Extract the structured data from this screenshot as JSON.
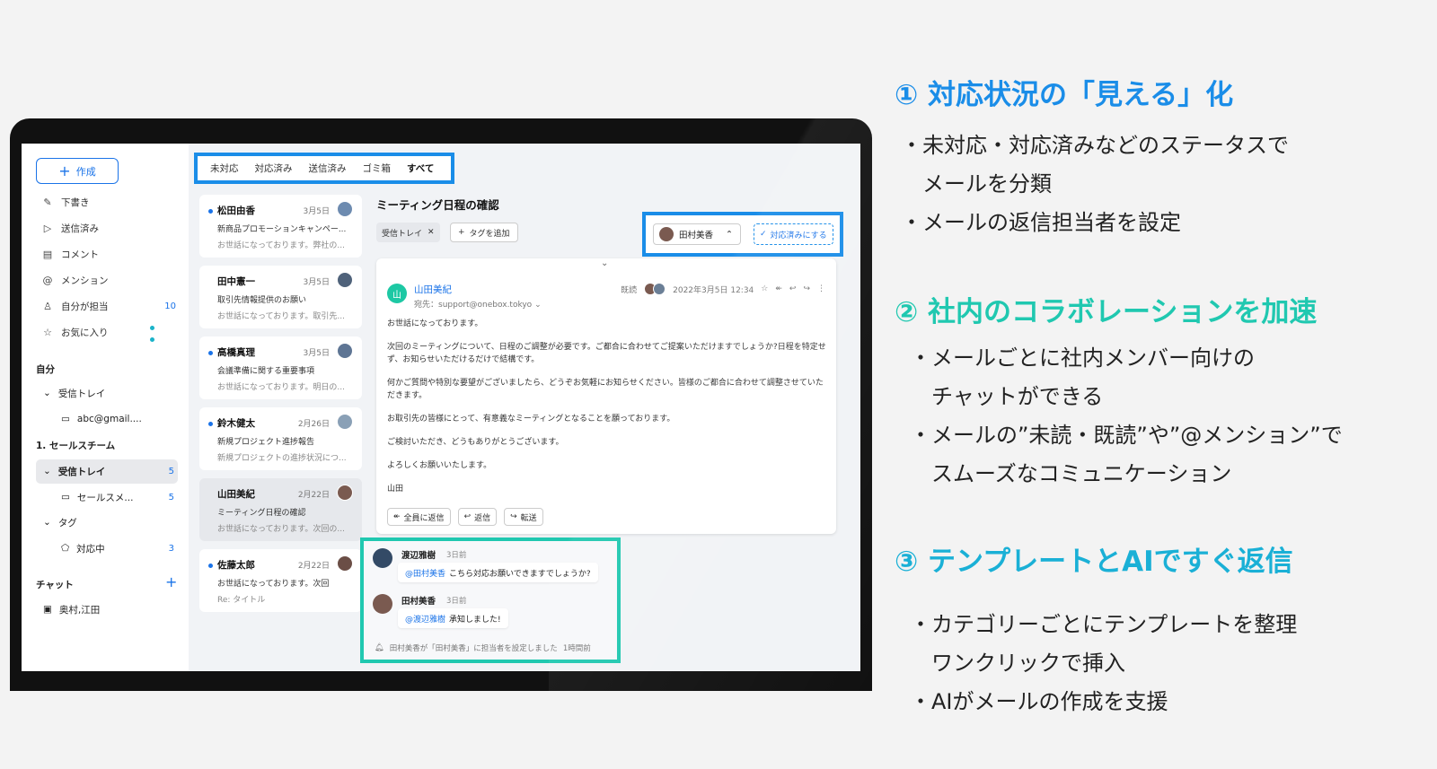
{
  "headings": {
    "h1": "① 対応状況の「見える」化",
    "h2": "② 社内のコラボレーションを加速",
    "h3": "③ テンプレートとAIですぐ返信"
  },
  "bullets": {
    "b1": [
      "・未対応・対応済みなどのステータスで",
      "　メールを分類",
      "・メールの返信担当者を設定"
    ],
    "b2": [
      "・メールごとに社内メンバー向けの",
      "　チャットができる",
      "・メールの”未読・既読”や”@メンション”で",
      "　スムーズなコミュニケーション"
    ],
    "b3": [
      "・カテゴリーごとにテンプレートを整理",
      "　ワンクリックで挿入",
      "・AIがメールの作成を支援"
    ]
  },
  "sidebar": {
    "compose": "作成",
    "items": [
      {
        "icon": "pencil-icon",
        "label": "下書き"
      },
      {
        "icon": "send-icon",
        "label": "送信済み"
      },
      {
        "icon": "comment-icon",
        "label": "コメント"
      },
      {
        "icon": "at-icon",
        "label": "メンション"
      },
      {
        "icon": "person-icon",
        "label": "自分が担当",
        "count": "10"
      },
      {
        "icon": "star-icon",
        "label": "お気に入り"
      }
    ],
    "self_title": "自分",
    "self_inbox": "受信トレイ",
    "self_account": "abc@gmail....",
    "team_title": "1. セールスチーム",
    "team_inbox": "受信トレイ",
    "team_inbox_count": "5",
    "team_account": "セールスメ...",
    "team_account_count": "5",
    "tag_title": "タグ",
    "tag_item": "対応中",
    "tag_item_count": "3",
    "chat_title": "チャット",
    "chat_item": "奥村,江田"
  },
  "tabs": [
    "未対応",
    "対応済み",
    "送信済み",
    "ゴミ箱",
    "すべて"
  ],
  "mail_list": [
    {
      "name": "松田由香",
      "date": "3月5日",
      "subject": "新商品プロモーションキャンペー...",
      "preview": "お世話になっております。弊社の...",
      "unread": true
    },
    {
      "name": "田中憲一",
      "date": "3月5日",
      "subject": "取引先情報提供のお願い",
      "preview": "お世話になっております。取引先...",
      "unread": false
    },
    {
      "name": "高橋真理",
      "date": "3月5日",
      "subject": "会議準備に関する重要事項",
      "preview": "お世話になっております。明日の...",
      "unread": true
    },
    {
      "name": "鈴木健太",
      "date": "2月26日",
      "subject": "新規プロジェクト進捗報告",
      "preview": "新規プロジェクトの進捗状況につ...",
      "unread": true
    },
    {
      "name": "山田美紀",
      "date": "2月22日",
      "subject": "ミーティング日程の確認",
      "preview": "お世話になっております。次回の...",
      "unread": false
    },
    {
      "name": "佐藤太郎",
      "date": "2月22日",
      "subject": "お世話になっております。次回",
      "preview": "Re: タイトル",
      "unread": true
    }
  ],
  "message": {
    "title": "ミーティング日程の確認",
    "tag": "受信トレイ",
    "add_tag": "タグを追加",
    "assignee": "田村美香",
    "done_button": "対応済みにする",
    "avatar_letter": "山",
    "from": "山田美紀",
    "to": "宛先：support@onebox.tokyo",
    "read_status": "既読",
    "datetime": "2022年3月5日 12:34",
    "body": [
      "お世話になっております。",
      "次回のミーティングについて、日程のご調整が必要です。ご都合に合わせてご提案いただけますでしょうか?日程を特定せず、お知らせいただけるだけで結構です。",
      "何かご質問や特別な要望がございましたら、どうぞお気軽にお知らせください。皆様のご都合に合わせて調整させていただきます。",
      "お取引先の皆様にとって、有意義なミーティングとなることを願っております。",
      "ご検討いただき、どうもありがとうございます。",
      "よろしくお願いいたします。",
      "山田"
    ],
    "reply_all": "全員に返信",
    "reply": "返信",
    "forward": "転送"
  },
  "chat": {
    "m1_name": "渡辺雅樹",
    "m1_time": "3日前",
    "m1_mention": "@田村美香",
    "m1_text": "こちら対応お願いできますでしょうか?",
    "m2_name": "田村美香",
    "m2_time": "3日前",
    "m2_mention": "@渡辺雅樹",
    "m2_text": "承知しました!",
    "footer": "田村美香が「田村美香」に担当者を設定しました",
    "footer_time": "1時間前"
  }
}
